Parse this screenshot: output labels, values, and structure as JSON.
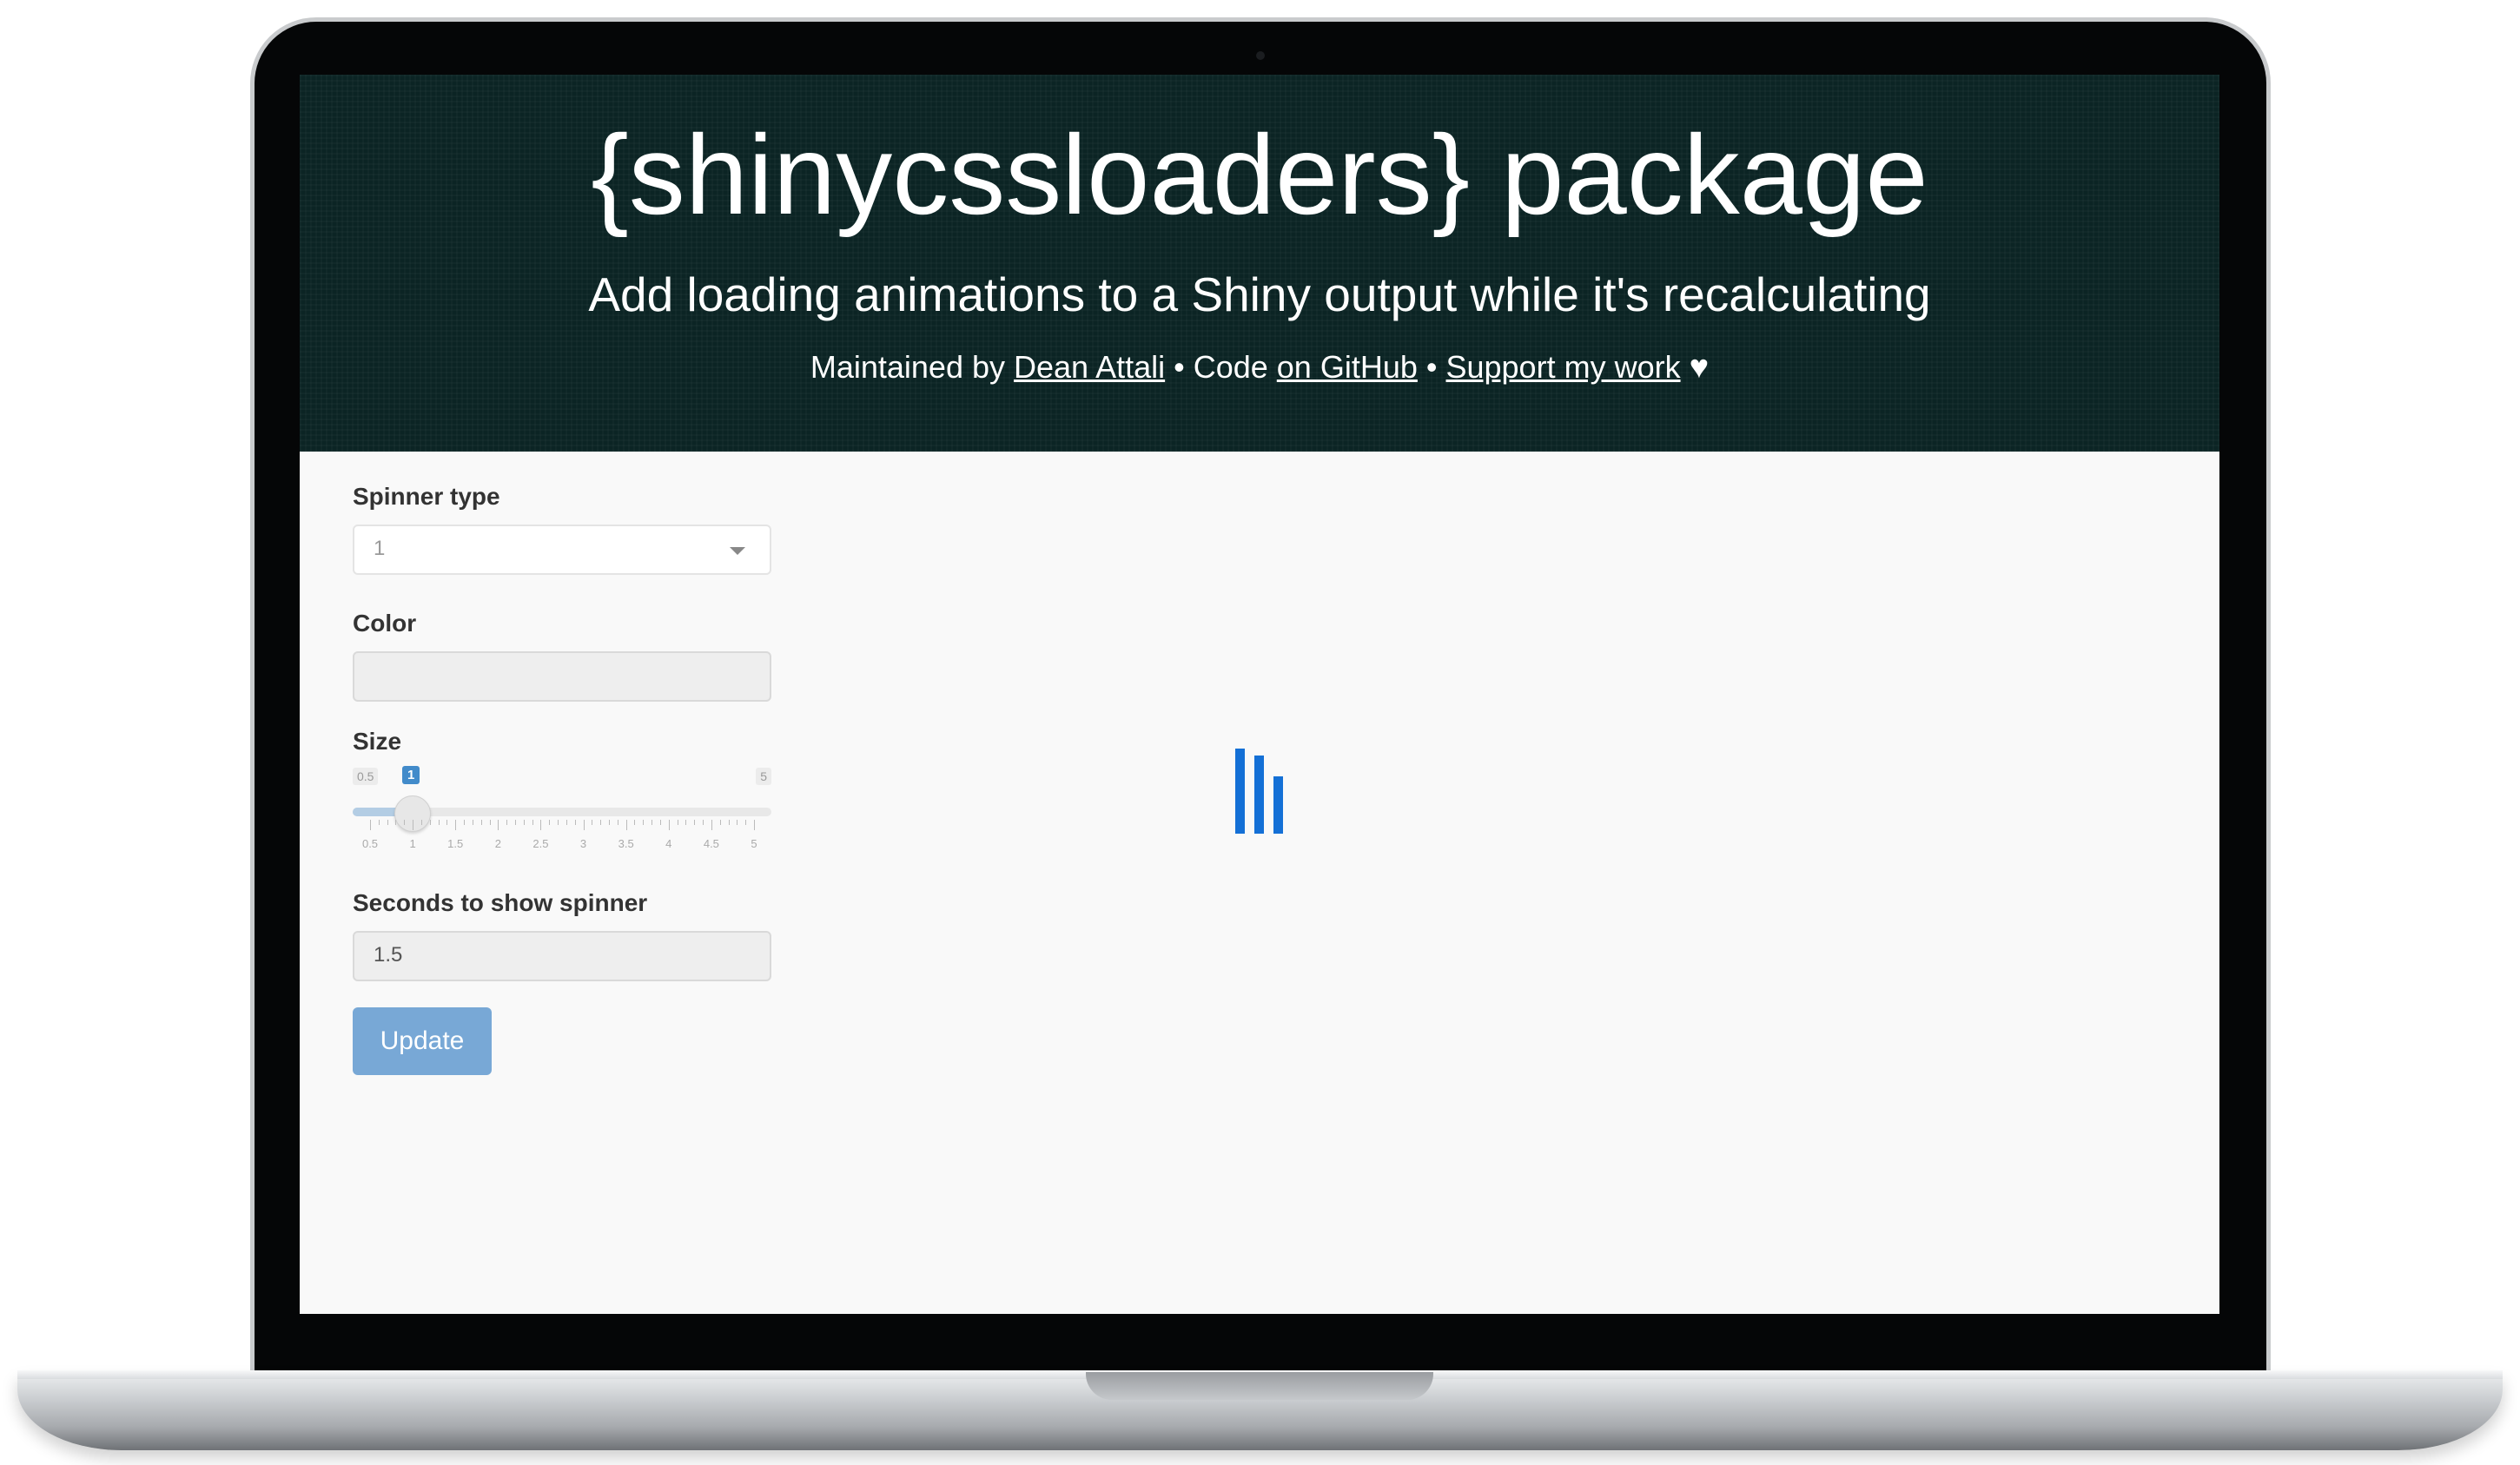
{
  "header": {
    "title": "{shinycssloaders} package",
    "subtitle": "Add loading animations to a Shiny output while it's recalculating",
    "credits": {
      "maintained_prefix": "Maintained by ",
      "author_link": "Dean Attali",
      "code_prefix": " • Code ",
      "github_link": "on GitHub",
      "separator": " • ",
      "support_link": "Support my work",
      "heart": "♥"
    }
  },
  "sidebar": {
    "spinner_type": {
      "label": "Spinner type",
      "selected": "1"
    },
    "color": {
      "label": "Color",
      "value": ""
    },
    "size": {
      "label": "Size",
      "min": "0.5",
      "max": "5",
      "value": "1",
      "value_fraction": 0.111,
      "ticks": [
        "0.5",
        "1",
        "1.5",
        "2",
        "2.5",
        "3",
        "3.5",
        "4",
        "4.5",
        "5"
      ]
    },
    "seconds": {
      "label": "Seconds to show spinner",
      "value": "1.5"
    },
    "update_button": "Update"
  },
  "colors": {
    "header_bg": "#0b2424",
    "button": "#78a8d6",
    "spinner": "#1470d6",
    "slider_value": "#428bca"
  }
}
